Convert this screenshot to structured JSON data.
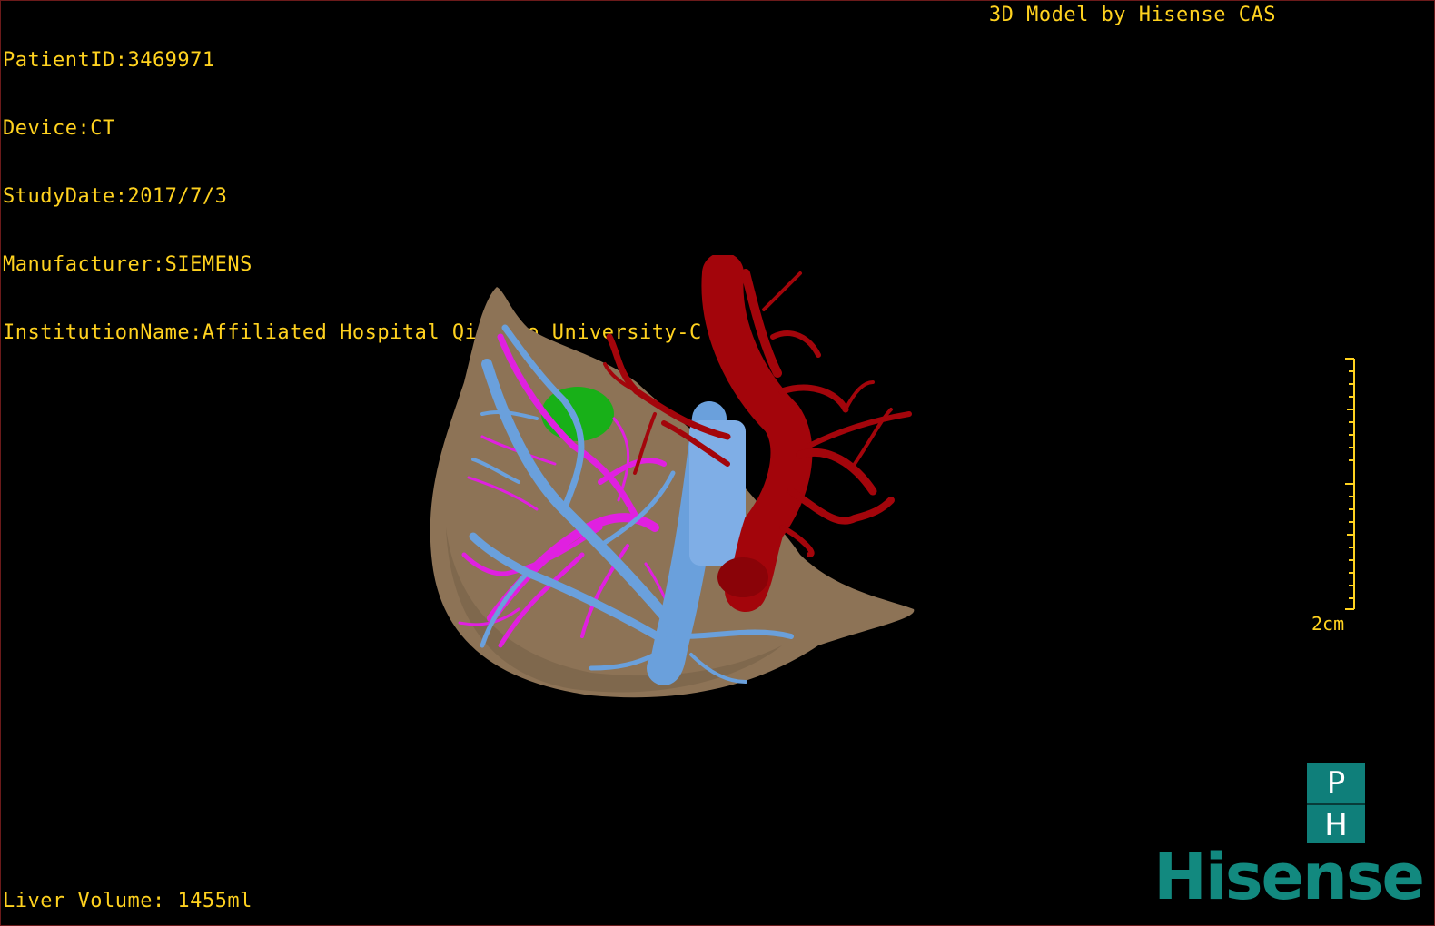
{
  "header": {
    "info_lines": [
      {
        "label": "PatientID:3469971"
      },
      {
        "label": "Device:CT"
      },
      {
        "label": "StudyDate:2017/7/3"
      },
      {
        "label": "Manufacturer:SIEMENS"
      },
      {
        "label": "InstitutionName:Affiliated Hospital Qingdao University-C"
      }
    ],
    "brand_text": "3D Model by Hisense CAS"
  },
  "footer": {
    "volume_text": "Liver Volume: 1455ml"
  },
  "scale_bar": {
    "label": "2cm"
  },
  "badge": {
    "top": "P",
    "bottom": "H"
  },
  "logo": {
    "text": "Hisense"
  },
  "colors": {
    "overlay_text": "#ffd21f",
    "liver": "#8d7356",
    "portal_vein": "#6aa0dc",
    "hepatic_vein": "#e020e0",
    "artery": "#a3050b",
    "lesion": "#18b018",
    "brand": "#12897f"
  },
  "model": {
    "icons": [
      "liver-surface",
      "portal-vein-tree",
      "hepatic-vein-tree",
      "artery-tree",
      "lesion"
    ]
  }
}
